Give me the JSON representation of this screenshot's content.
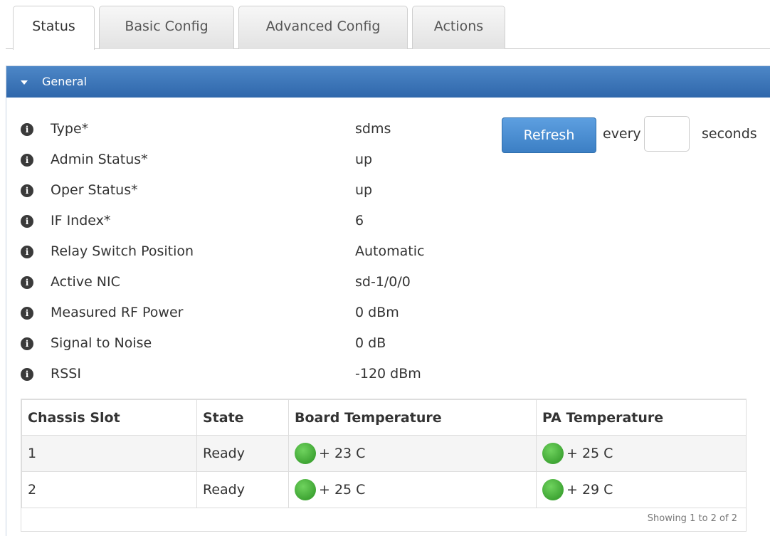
{
  "tabs": [
    {
      "label": "Status",
      "active": true
    },
    {
      "label": "Basic Config",
      "active": false
    },
    {
      "label": "Advanced Config",
      "active": false
    },
    {
      "label": "Actions",
      "active": false
    }
  ],
  "panel": {
    "title": "General",
    "header_color": "#3d74b8"
  },
  "properties": [
    {
      "label": "Type*",
      "value": "sdms"
    },
    {
      "label": "Admin Status*",
      "value": "up"
    },
    {
      "label": "Oper Status*",
      "value": "up"
    },
    {
      "label": "IF Index*",
      "value": "6"
    },
    {
      "label": "Relay Switch Position",
      "value": "Automatic"
    },
    {
      "label": "Active NIC",
      "value": "sd-1/0/0"
    },
    {
      "label": "Measured RF Power",
      "value": "0 dBm"
    },
    {
      "label": "Signal to Noise",
      "value": "0 dB"
    },
    {
      "label": "RSSI",
      "value": "-120 dBm"
    }
  ],
  "info_icon": {
    "glyph": "i",
    "name": "info-icon"
  },
  "refresh": {
    "button_label": "Refresh",
    "every_label": "every",
    "seconds_value": "",
    "seconds_label": "seconds",
    "button_color": "#4a8fd4"
  },
  "table": {
    "columns": [
      "Chassis Slot",
      "State",
      "Board Temperature",
      "PA Temperature"
    ],
    "rows": [
      {
        "slot": "1",
        "state": "Ready",
        "board_temp": "+ 23 C",
        "pa_temp": "+ 25 C",
        "board_status": "ok",
        "pa_status": "ok"
      },
      {
        "slot": "2",
        "state": "Ready",
        "board_temp": "+ 25 C",
        "pa_temp": "+ 29 C",
        "board_status": "ok",
        "pa_status": "ok"
      }
    ],
    "status_color_ok": "#4cb33f",
    "footer": "Showing 1 to 2 of 2"
  }
}
